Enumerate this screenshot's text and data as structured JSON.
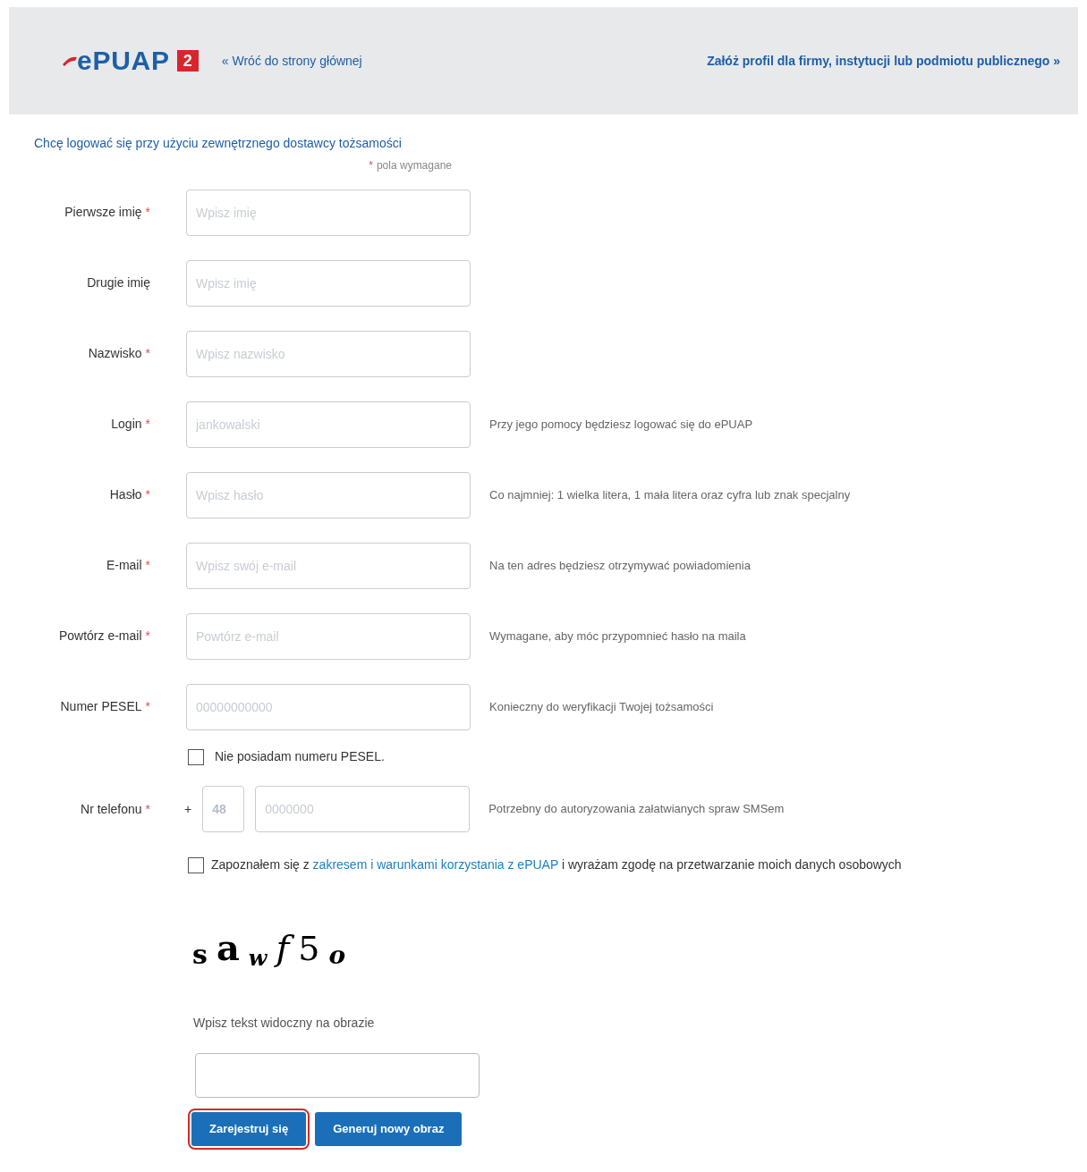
{
  "header": {
    "logo": {
      "text": "ePUAP",
      "badge": "2"
    },
    "back_link": "« Wróć do strony głównej",
    "profile_link": "Załóż profil dla firmy, instytucji lub podmiotu publicznego »"
  },
  "external_login_link": "Chcę logować się przy użyciu zewnętrznego dostawcy tożsamości",
  "required_note": {
    "mark": "*",
    "text": "pola wymagane"
  },
  "fields": [
    {
      "kind": "text",
      "label": "Pierwsze imię",
      "required": true,
      "placeholder": "Wpisz imię"
    },
    {
      "kind": "text",
      "label": "Drugie imię",
      "required": false,
      "placeholder": "Wpisz imię"
    },
    {
      "kind": "text",
      "label": "Nazwisko",
      "required": true,
      "placeholder": "Wpisz nazwisko"
    },
    {
      "kind": "text",
      "label": "Login",
      "required": true,
      "placeholder": "jankowalski",
      "hint": "Przy jego pomocy będziesz logować się do ePUAP"
    },
    {
      "kind": "text",
      "label": "Hasło",
      "required": true,
      "placeholder": "Wpisz hasło",
      "hint": "Co najmniej: 1 wielka litera, 1 mała litera oraz cyfra lub znak specjalny"
    },
    {
      "kind": "text",
      "label": "E-mail",
      "required": true,
      "placeholder": "Wpisz swój e-mail",
      "hint": "Na ten adres będziesz otrzymywać powiadomienia"
    },
    {
      "kind": "text",
      "label": "Powtórz e-mail",
      "required": true,
      "placeholder": "Powtórz e-mail",
      "hint": "Wymagane, aby móc przypomnieć hasło na maila"
    },
    {
      "kind": "text",
      "label": "Numer PESEL",
      "required": true,
      "placeholder": "00000000000",
      "hint": "Konieczny do weryfikacji Twojej tożsamości"
    },
    {
      "kind": "checkbox",
      "label": "Nie posiadam numeru PESEL.",
      "checked": false
    },
    {
      "kind": "phone",
      "label": "Nr telefonu",
      "required": true,
      "prefix": "+",
      "code_placeholder": "48",
      "placeholder": "0000000",
      "hint": "Potrzebny do autoryzowania załatwianych spraw SMSem"
    }
  ],
  "consent": {
    "checked": false,
    "before": "Zapoznałem się z",
    "link": "zakresem i warunkami korzystania z ePUAP",
    "after": "i wyrażam zgodę na przetwarzanie moich danych osobowych"
  },
  "captcha": {
    "text": "sawf5o",
    "label": "Wpisz tekst widoczny na obrazie"
  },
  "buttons": [
    {
      "label": "Zarejestruj się",
      "highlighted": true
    },
    {
      "label": "Generuj nowy obraz",
      "highlighted": false
    }
  ]
}
